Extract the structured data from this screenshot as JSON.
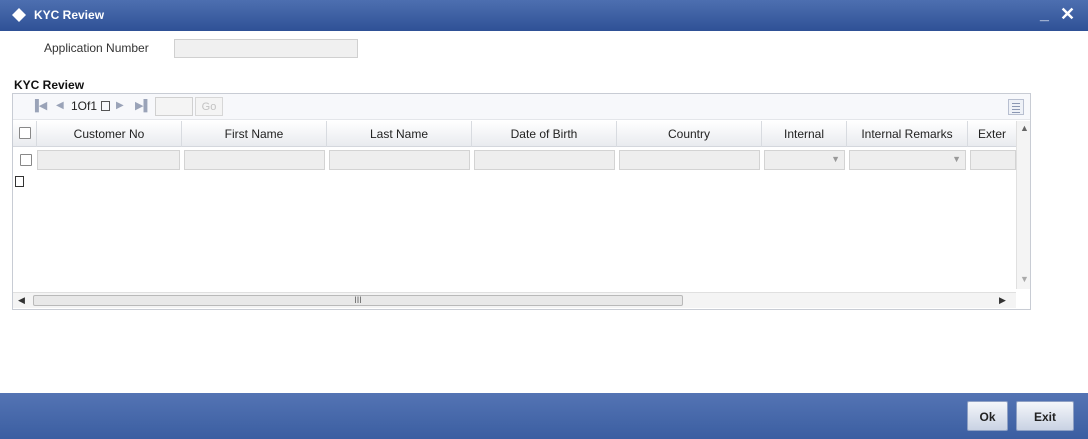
{
  "window": {
    "title": "KYC Review",
    "minimize_glyph": "_",
    "close_glyph": "✕"
  },
  "form": {
    "application_number_label": "Application Number",
    "application_number_value": ""
  },
  "section": {
    "title": "KYC Review"
  },
  "pager": {
    "first_icon": "first-page-icon",
    "prev_icon": "prev-page-icon",
    "text": "1Of1",
    "next_icon": "next-page-icon",
    "last_icon": "last-page-icon",
    "page_input": "",
    "go_label": "Go"
  },
  "grid": {
    "columns": [
      "Customer No",
      "First Name",
      "Last Name",
      "Date of Birth",
      "Country",
      "Internal",
      "Internal Remarks",
      "Exter"
    ],
    "rows": [
      {
        "customer_no": "",
        "first_name": "",
        "last_name": "",
        "date_of_birth": "",
        "country": "",
        "internal": "",
        "internal_remarks": "",
        "external": ""
      }
    ],
    "hscroll_thumb_label": "III"
  },
  "footer": {
    "ok_label": "Ok",
    "exit_label": "Exit"
  },
  "colors": {
    "titlebar": "#3a5ca0",
    "footer": "#4769ab",
    "button": "#dbe2ef"
  }
}
